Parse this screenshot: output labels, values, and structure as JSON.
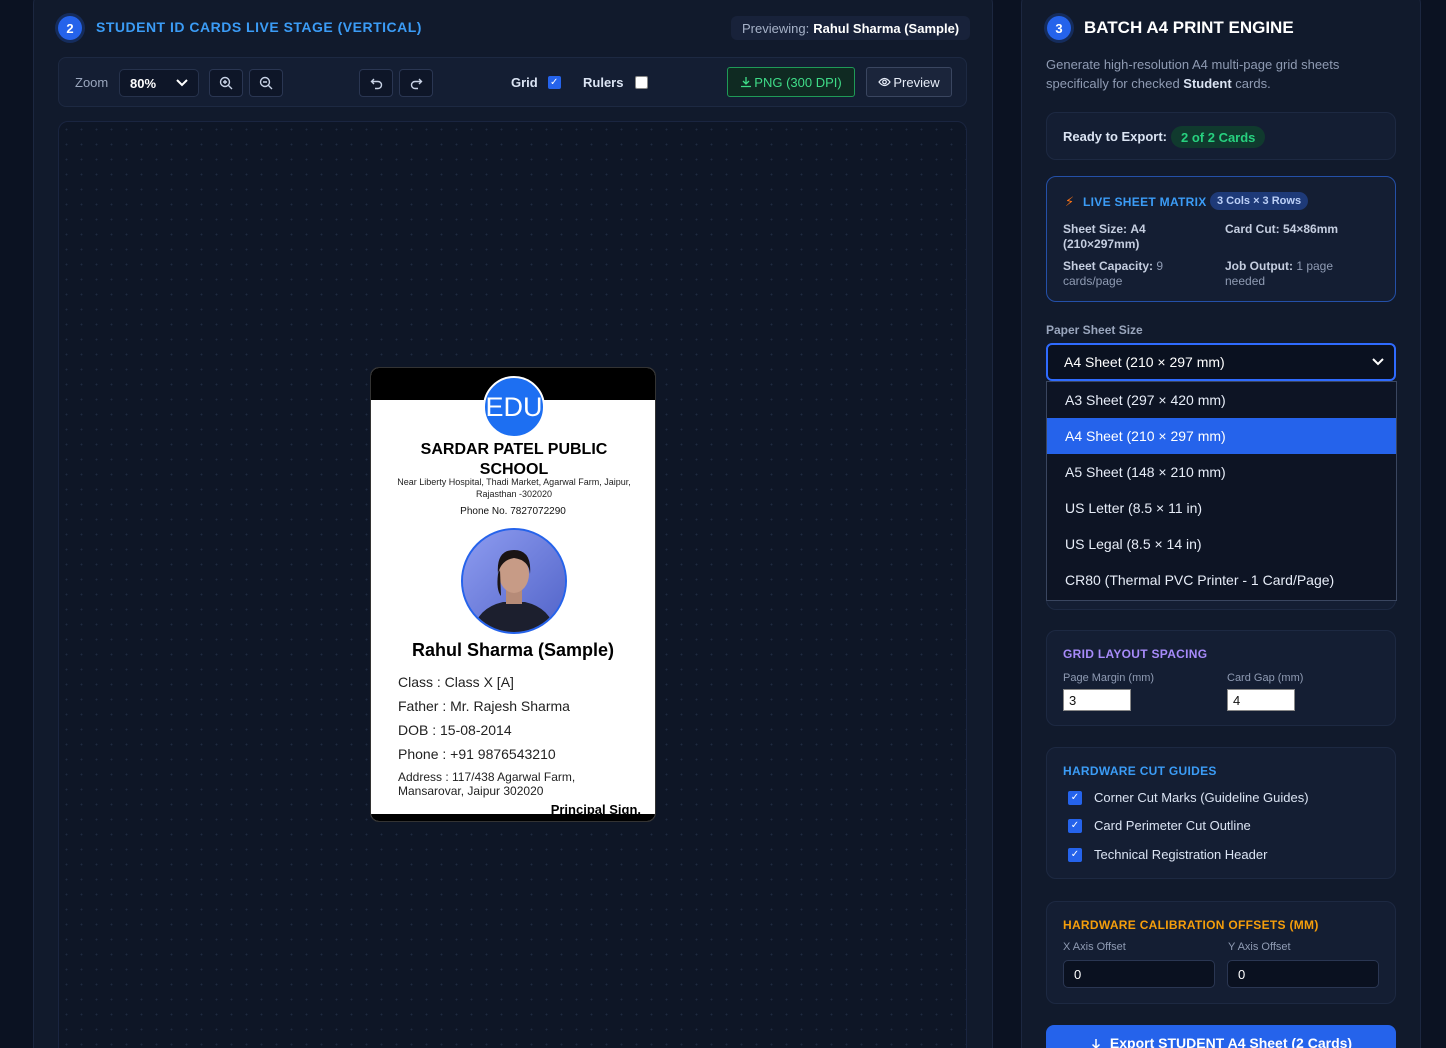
{
  "stage": {
    "step": "2",
    "title": "STUDENT ID CARDS LIVE STAGE (VERTICAL)",
    "previewing_label": "Previewing:",
    "previewing_name": "Rahul Sharma (Sample)"
  },
  "toolbar": {
    "zoom_label": "Zoom",
    "zoom_value": "80%",
    "grid_label": "Grid",
    "grid_checked": true,
    "rulers_label": "Rulers",
    "rulers_checked": false,
    "png_label": "PNG (300 DPI)",
    "preview_label": "Preview"
  },
  "card": {
    "logo_text": "EDU",
    "school_name": "SARDAR PATEL PUBLIC SCHOOL",
    "address": "Near Liberty Hospital, Thadi Market, Agarwal Farm, Jaipur, Rajasthan -302020",
    "phone": "Phone No. 7827072290",
    "student_name": "Rahul Sharma (Sample)",
    "class": "Class : Class X [A]",
    "father": "Father : Mr. Rajesh Sharma",
    "dob": "DOB : 15-08-2014",
    "student_phone": "Phone : +91 9876543210",
    "student_address": "Address : 117/438 Agarwal Farm, Mansarovar, Jaipur 302020",
    "principal": "Principal Sign."
  },
  "engine": {
    "step": "3",
    "title": "BATCH A4 PRINT ENGINE",
    "desc_prefix": "Generate high-resolution A4 multi-page grid sheets specifically for checked ",
    "desc_bold": "Student",
    "desc_suffix": " cards.",
    "ready_label": "Ready to Export:",
    "ready_count": "2 of 2 Cards",
    "matrix": {
      "title": "LIVE SHEET MATRIX",
      "pill": "3 Cols × 3 Rows",
      "sheet_size_label": "Sheet Size:",
      "sheet_size_value": "A4 (210×297mm)",
      "card_cut_label": "Card Cut:",
      "card_cut_value": "54×86mm",
      "capacity_label": "Sheet Capacity:",
      "capacity_value": "9 cards/page",
      "output_label": "Job Output:",
      "output_value": "1 page needed"
    },
    "paper_label": "Paper Sheet Size",
    "paper_value": "A4 Sheet (210 × 297 mm)",
    "paper_options": [
      "A3 Sheet (297 × 420 mm)",
      "A4 Sheet (210 × 297 mm)",
      "A5 Sheet (148 × 210 mm)",
      "US Letter (8.5 × 11 in)",
      "US Legal (8.5 × 14 in)",
      "CR80 (Thermal PVC Printer - 1 Card/Page)"
    ],
    "spacing": {
      "title": "GRID LAYOUT SPACING",
      "margin_label": "Page Margin (mm)",
      "margin_value": "3",
      "gap_label": "Card Gap (mm)",
      "gap_value": "4"
    },
    "cut_guides": {
      "title": "HARDWARE CUT GUIDES",
      "items": [
        "Corner Cut Marks (Guideline Guides)",
        "Card Perimeter Cut Outline",
        "Technical Registration Header"
      ]
    },
    "calibration": {
      "title": "HARDWARE CALIBRATION OFFSETS (MM)",
      "x_label": "X Axis Offset",
      "x_value": "0",
      "y_label": "Y Axis Offset",
      "y_value": "0"
    },
    "export_label": "Export STUDENT A4 Sheet (2 Cards)"
  },
  "colors": {
    "accent": "#2563eb",
    "accent_text": "#3b9cf6",
    "success": "#27d17f",
    "spacing_title": "#a78bfa",
    "calibration_title": "#f59e0b"
  }
}
